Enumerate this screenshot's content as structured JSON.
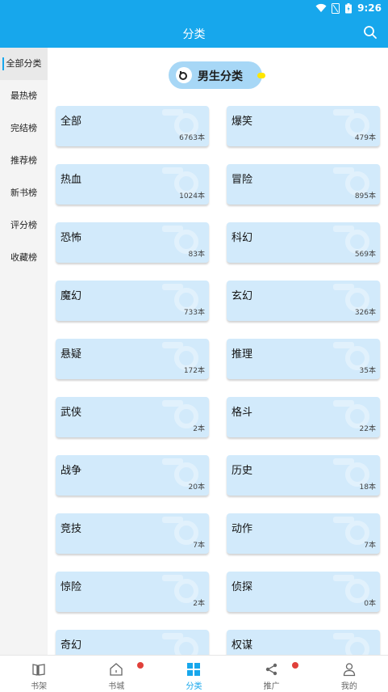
{
  "status_bar": {
    "time": "9:26"
  },
  "app_bar": {
    "title": "分类"
  },
  "sidebar": {
    "items": [
      {
        "label": "全部分类",
        "active": true
      },
      {
        "label": "最热榜",
        "active": false
      },
      {
        "label": "完结榜",
        "active": false
      },
      {
        "label": "推荐榜",
        "active": false
      },
      {
        "label": "新书榜",
        "active": false
      },
      {
        "label": "评分榜",
        "active": false
      },
      {
        "label": "收藏榜",
        "active": false
      }
    ]
  },
  "section": {
    "title": "男生分类"
  },
  "categories": [
    {
      "name": "全部",
      "count": "6763本"
    },
    {
      "name": "爆笑",
      "count": "479本"
    },
    {
      "name": "热血",
      "count": "1024本"
    },
    {
      "name": "冒险",
      "count": "895本"
    },
    {
      "name": "恐怖",
      "count": "83本"
    },
    {
      "name": "科幻",
      "count": "569本"
    },
    {
      "name": "魔幻",
      "count": "733本"
    },
    {
      "name": "玄幻",
      "count": "326本"
    },
    {
      "name": "悬疑",
      "count": "172本"
    },
    {
      "name": "推理",
      "count": "35本"
    },
    {
      "name": "武侠",
      "count": "2本"
    },
    {
      "name": "格斗",
      "count": "22本"
    },
    {
      "name": "战争",
      "count": "20本"
    },
    {
      "name": "历史",
      "count": "18本"
    },
    {
      "name": "竞技",
      "count": "7本"
    },
    {
      "name": "动作",
      "count": "7本"
    },
    {
      "name": "惊险",
      "count": "2本"
    },
    {
      "name": "侦探",
      "count": "0本"
    },
    {
      "name": "奇幻",
      "count": ""
    },
    {
      "name": "权谋",
      "count": ""
    }
  ],
  "bottom_nav": {
    "items": [
      {
        "label": "书架",
        "icon": "bookshelf-icon",
        "active": false,
        "badge": false
      },
      {
        "label": "书城",
        "icon": "home-icon",
        "active": false,
        "badge": true
      },
      {
        "label": "分类",
        "icon": "category-grid-icon",
        "active": true,
        "badge": false
      },
      {
        "label": "推广",
        "icon": "share-icon",
        "active": false,
        "badge": true
      },
      {
        "label": "我的",
        "icon": "profile-icon",
        "active": false,
        "badge": false
      }
    ]
  },
  "colors": {
    "primary": "#17a7ec",
    "card": "#d2eafb",
    "pill": "#a7d7f6",
    "badge": "#e0403a"
  }
}
